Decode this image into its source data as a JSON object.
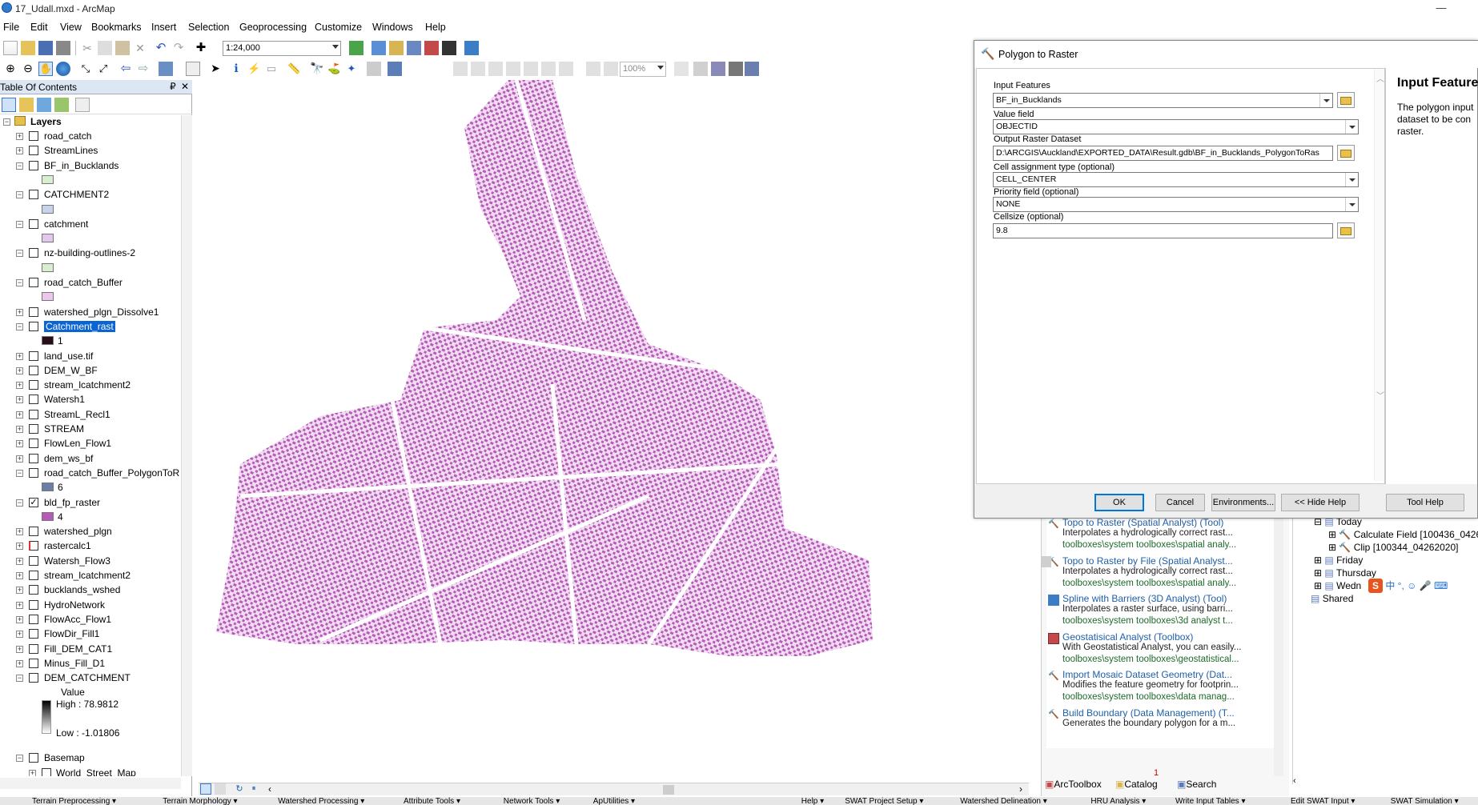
{
  "window": {
    "title": "17_Udall.mxd - ArcMap",
    "minimize": "—"
  },
  "menu": [
    "File",
    "Edit",
    "View",
    "Bookmarks",
    "Insert",
    "Selection",
    "Geoprocessing",
    "Customize",
    "Windows",
    "Help"
  ],
  "toolbar": {
    "scale": "1:24,000",
    "zoom": "100%"
  },
  "toc": {
    "title": "Table Of Contents",
    "pin": "₽",
    "close": "✕",
    "root": "Layers",
    "layers": [
      {
        "name": "road_catch",
        "checked": false,
        "expanded": false
      },
      {
        "name": "StreamLines",
        "checked": false,
        "expanded": false
      },
      {
        "name": "BF_in_Bucklands",
        "checked": false,
        "expanded": true,
        "swatch": "#d8efcf"
      },
      {
        "name": "CATCHMENT2",
        "checked": false,
        "expanded": true,
        "swatch": "#c6d3ea"
      },
      {
        "name": "catchment",
        "checked": false,
        "expanded": true,
        "swatch": "#e2c7ee"
      },
      {
        "name": "nz-building-outlines-2",
        "checked": false,
        "expanded": true,
        "swatch": "#d8efcf"
      },
      {
        "name": "road_catch_Buffer",
        "checked": false,
        "expanded": true,
        "swatch": "#ecc6ec"
      },
      {
        "name": "watershed_plgn_Dissolve1",
        "checked": false,
        "expanded": false
      },
      {
        "name": "Catchment_rast",
        "checked": false,
        "expanded": true,
        "selected": true,
        "legend": "1",
        "swatch": "#2a0d1a"
      },
      {
        "name": "land_use.tif",
        "checked": false,
        "expanded": false
      },
      {
        "name": "DEM_W_BF",
        "checked": false,
        "expanded": false
      },
      {
        "name": "stream_lcatchment2",
        "checked": false,
        "expanded": false
      },
      {
        "name": "Watersh1",
        "checked": false,
        "expanded": false
      },
      {
        "name": "StreamL_Recl1",
        "checked": false,
        "expanded": false
      },
      {
        "name": "STREAM",
        "checked": false,
        "expanded": false
      },
      {
        "name": "FlowLen_Flow1",
        "checked": false,
        "expanded": false
      },
      {
        "name": "dem_ws_bf",
        "checked": false,
        "expanded": false
      },
      {
        "name": "road_catch_Buffer_PolygonToR",
        "checked": false,
        "expanded": true,
        "legend": "6",
        "swatch": "#6a7ea8"
      },
      {
        "name": "bld_fp_raster",
        "checked": true,
        "expanded": true,
        "legend": "4",
        "swatch": "#b65bb9"
      },
      {
        "name": "watershed_plgn",
        "checked": false,
        "expanded": false
      },
      {
        "name": "rastercalc1",
        "checked": false,
        "expanded": false,
        "redcheck": true
      },
      {
        "name": "Watersh_Flow3",
        "checked": false,
        "expanded": false
      },
      {
        "name": "stream_lcatchment2",
        "checked": false,
        "expanded": false
      },
      {
        "name": "bucklands_wshed",
        "checked": false,
        "expanded": false
      },
      {
        "name": "HydroNetwork",
        "checked": false,
        "expanded": false
      },
      {
        "name": "FlowAcc_Flow1",
        "checked": false,
        "expanded": false
      },
      {
        "name": "FlowDir_Fill1",
        "checked": false,
        "expanded": false
      },
      {
        "name": "Fill_DEM_CAT1",
        "checked": false,
        "expanded": false
      },
      {
        "name": "Minus_Fill_D1",
        "checked": false,
        "expanded": false
      },
      {
        "name": "DEM_CATCHMENT",
        "checked": false,
        "expanded": true
      }
    ],
    "dem_legend": {
      "value": "Value",
      "high": "High : 78.9812",
      "low": "Low : -1.01806"
    },
    "basemap": {
      "group": "Basemap",
      "child": "World_Street_Map"
    }
  },
  "dialog": {
    "title": "Polygon to Raster",
    "fields": {
      "input_features_label": "Input Features",
      "input_features_value": "BF_in_Bucklands",
      "value_field_label": "Value field",
      "value_field_value": "OBJECTID",
      "output_label": "Output Raster Dataset",
      "output_value": "D:\\ARCGIS\\Auckland\\EXPORTED_DATA\\Result.gdb\\BF_in_Bucklands_PolygonToRas",
      "cell_assign_label": "Cell assignment type (optional)",
      "cell_assign_value": "CELL_CENTER",
      "priority_label": "Priority field (optional)",
      "priority_value": "NONE",
      "cellsize_label": "Cellsize (optional)",
      "cellsize_value": "9.8"
    },
    "help_title": "Input Feature",
    "help_text": "The polygon input dataset to be con raster.",
    "buttons": {
      "ok": "OK",
      "cancel": "Cancel",
      "env": "Environments...",
      "hide_help": "<< Hide Help",
      "tool_help": "Tool Help"
    }
  },
  "search": {
    "results": [
      {
        "title": "Topo to Raster (Spatial Analyst) (Tool)",
        "desc": "Interpolates a hydrologically correct rast...",
        "path": "toolboxes\\system toolboxes\\spatial analy...",
        "icon": "hammer"
      },
      {
        "title": "Topo to Raster by File (Spatial Analyst...",
        "desc": "Interpolates a hydrologically correct rast...",
        "path": "toolboxes\\system toolboxes\\spatial analy...",
        "icon": "hammer"
      },
      {
        "title": "Spline with Barriers (3D Analyst) (Tool)",
        "desc": "Interpolates a raster surface, using barri...",
        "path": "toolboxes\\system toolboxes\\3d analyst t...",
        "icon": "script"
      },
      {
        "title": "Geostatisical Analyst (Toolbox)",
        "desc": "With Geostatistical Analyst, you can easily...",
        "path": "toolboxes\\system toolboxes\\geostatistical...",
        "icon": "toolbox"
      },
      {
        "title": "Import Mosaic Dataset Geometry (Dat...",
        "desc": "Modifies the feature geometry for footprin...",
        "path": "toolboxes\\system toolboxes\\data manag...",
        "icon": "hammer"
      },
      {
        "title": "Build Boundary (Data Management) (T...",
        "desc": "Generates the boundary polygon for a m...",
        "path": "",
        "icon": "hammer"
      }
    ],
    "page": "1",
    "tabs": [
      "ArcToolbox",
      "Catalog",
      "Search"
    ]
  },
  "history": {
    "today": "Today",
    "items": [
      "Calculate Field [100436_04262",
      "Clip [100344_04262020]"
    ],
    "friday": "Friday",
    "thursday": "Thursday",
    "wednesday": "Wedn",
    "shared": "Shared",
    "ime": "中 °, ☺ 🎤 ⌨"
  },
  "bottom_strip": [
    "Terrain Preprocessing ▾",
    "Terrain Morphology ▾",
    "Watershed Processing ▾",
    "Attribute Tools ▾",
    "Network Tools ▾",
    "ApUtilities ▾",
    "Help ▾",
    "SWAT Project Setup ▾",
    "Watershed Delineation ▾",
    "HRU Analysis ▾",
    "Write Input Tables ▾",
    "Edit SWAT Input ▾",
    "SWAT Simulation ▾"
  ]
}
